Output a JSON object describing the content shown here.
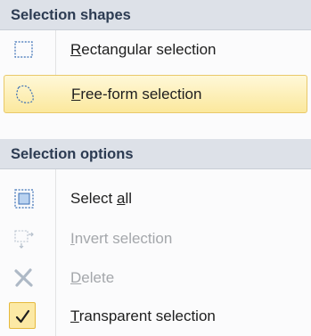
{
  "sections": {
    "shapes": {
      "title": "Selection shapes"
    },
    "options": {
      "title": "Selection options"
    }
  },
  "items": {
    "rectangular": {
      "label_prefix": "",
      "mnemonic": "R",
      "label_rest": "ectangular selection"
    },
    "freeform": {
      "label_prefix": "",
      "mnemonic": "F",
      "label_rest": "ree-form selection"
    },
    "select_all": {
      "label_prefix": "Select ",
      "mnemonic": "a",
      "label_rest": "ll"
    },
    "invert": {
      "label_prefix": "",
      "mnemonic": "I",
      "label_rest": "nvert selection"
    },
    "delete": {
      "label_prefix": "",
      "mnemonic": "D",
      "label_rest": "elete"
    },
    "transparent": {
      "label_prefix": "",
      "mnemonic": "T",
      "label_rest": "ransparent selection",
      "checked": true
    }
  },
  "icons": {
    "rectangular": "rectangle-selection-icon",
    "freeform": "freeform-selection-icon",
    "select_all": "select-all-icon",
    "invert": "invert-selection-icon",
    "delete": "delete-icon",
    "transparent": "checkmark-icon"
  },
  "colors": {
    "header_bg": "#dde1e8",
    "header_text": "#2c3b52",
    "highlight_bg": "#fbe89d",
    "highlight_border": "#e9c96a",
    "disabled_text": "#a4a7ab"
  }
}
